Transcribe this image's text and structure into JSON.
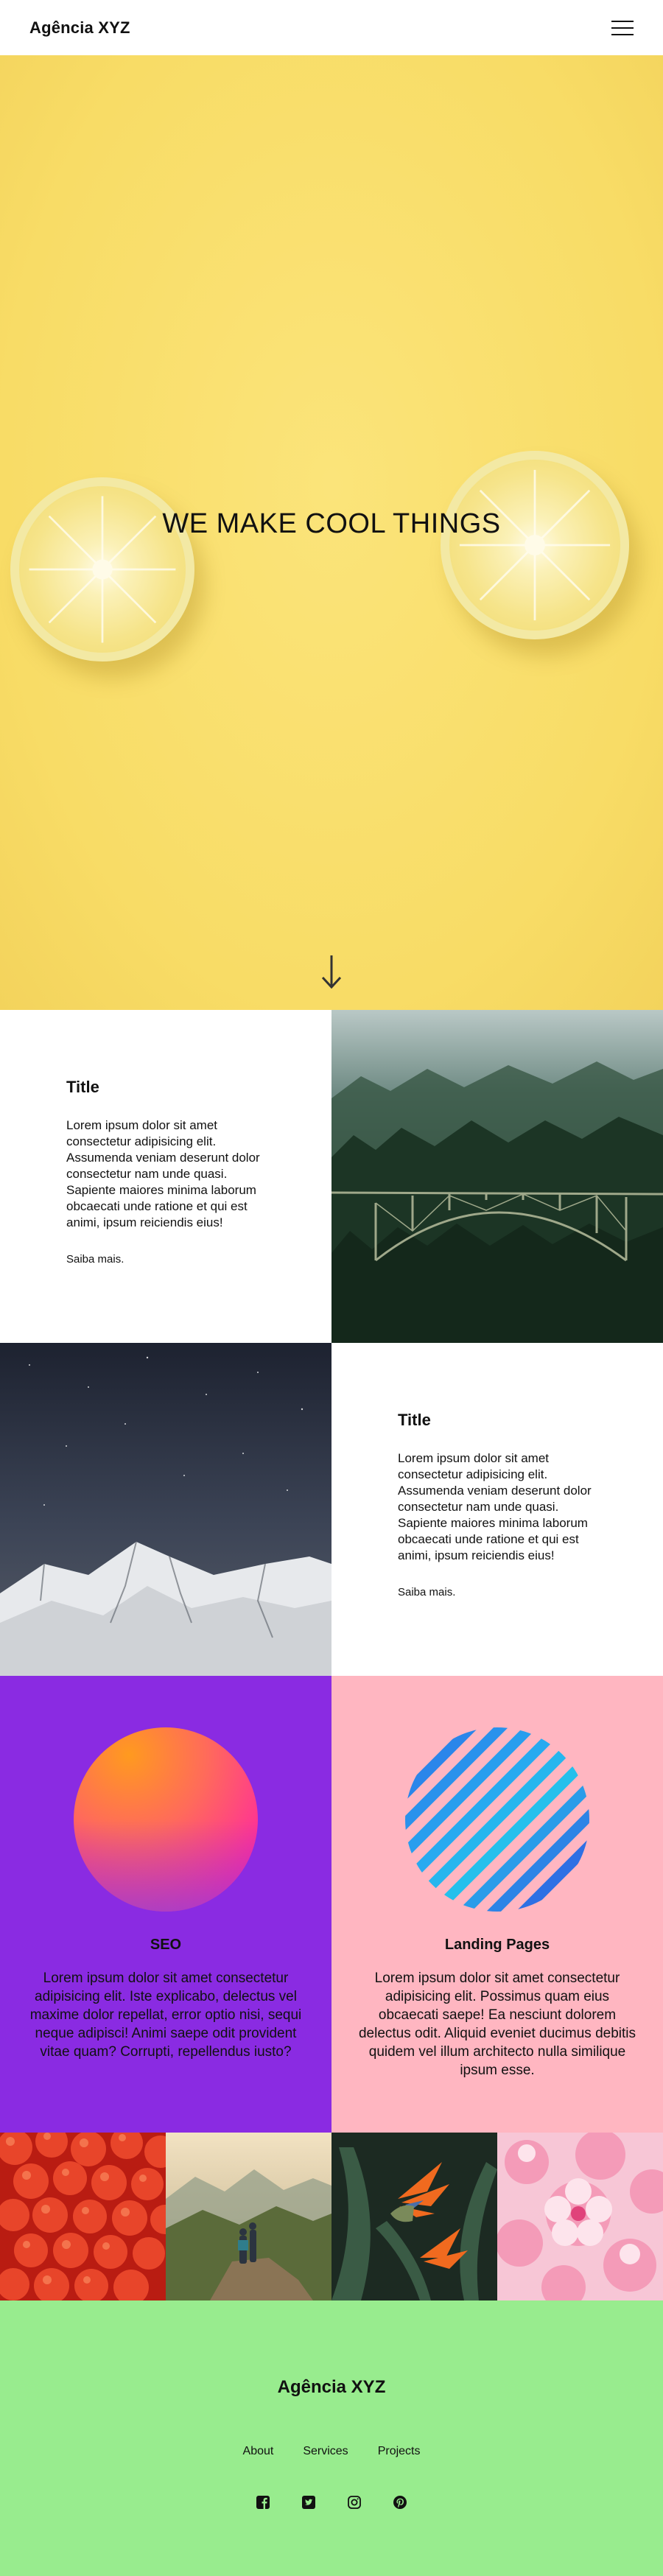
{
  "header": {
    "brand": "Agência XYZ",
    "menu_icon": "hamburger-menu-icon"
  },
  "hero": {
    "title": "WE MAKE COOL THINGS",
    "background_color": "#f8dc66",
    "scroll_icon": "arrow-down-icon"
  },
  "features": [
    {
      "title": "Title",
      "body": "Lorem ipsum dolor sit amet consectetur adipisicing elit. Assumenda veniam deserunt dolor consectetur nam unde quasi. Sapiente maiores minima laborum obcaecati unde ratione et qui est animi, ipsum reiciendis eius!",
      "link": "Saiba mais.",
      "image": "forest-bridge-photo"
    },
    {
      "title": "Title",
      "body": "Lorem ipsum dolor sit amet consectetur adipisicing elit. Assumenda veniam deserunt dolor consectetur nam unde quasi. Sapiente maiores minima laborum obcaecati unde ratione et qui est animi, ipsum reiciendis eius!",
      "link": "Saiba mais.",
      "image": "snowy-mountain-night-photo"
    }
  ],
  "services": [
    {
      "title": "SEO",
      "body": "Lorem ipsum dolor sit amet consectetur adipisicing elit. Iste explicabo, delectus vel maxime dolor repellat, error optio nisi, sequi neque adipisci! Animi saepe odit provident vitae quam? Corrupti, repellendus iusto?",
      "background_color": "#8a2be2",
      "graphic": "gradient-orb"
    },
    {
      "title": "Landing Pages",
      "body": "Lorem ipsum dolor sit amet consectetur adipisicing elit. Possimus quam eius obcaecati saepe! Ea nesciunt dolorem delectus odit. Aliquid eveniet ducimus debitis quidem vel illum architecto nulla similique ipsum esse.",
      "background_color": "#ffb6c1",
      "graphic": "striped-orb"
    }
  ],
  "gallery": [
    "tomatoes-photo",
    "hikers-mountain-photo",
    "bird-of-paradise-flower-photo",
    "pink-blossoms-photo"
  ],
  "footer": {
    "brand": "Agência XYZ",
    "background_color": "#98ec8e",
    "links": [
      "About",
      "Services",
      "Projects"
    ],
    "social": [
      "facebook-icon",
      "twitter-icon",
      "instagram-icon",
      "pinterest-icon"
    ]
  }
}
